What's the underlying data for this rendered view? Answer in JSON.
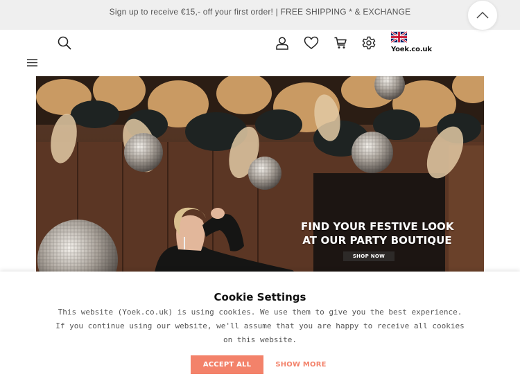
{
  "promo": {
    "text": "Sign up to receive €15,- off your first order! | FREE SHIPPING * & EXCHANGE"
  },
  "header": {
    "brand": "Yoek.co.uk",
    "icons": [
      "search-icon",
      "account-icon",
      "wishlist-icon",
      "cart-icon",
      "settings-icon",
      "uk-flag-icon",
      "menu-icon",
      "chevron-up-icon"
    ]
  },
  "hero": {
    "headline_line1": "FIND YOUR FESTIVE LOOK",
    "headline_line2": "AT OUR PARTY BOUTIQUE",
    "cta": "SHOP NOW"
  },
  "cookie": {
    "title": "Cookie Settings",
    "text": "This website (Yoek.co.uk) is using cookies. We use them to give you the best experience. If you continue using our website, we'll assume that you are happy to receive all cookies on this website.",
    "accept_label": "ACCEPT ALL",
    "more_label": "SHOW MORE"
  },
  "colors": {
    "accent": "#f3826a",
    "promo_bg": "#efefef",
    "cta_bg": "#2d2a28"
  }
}
